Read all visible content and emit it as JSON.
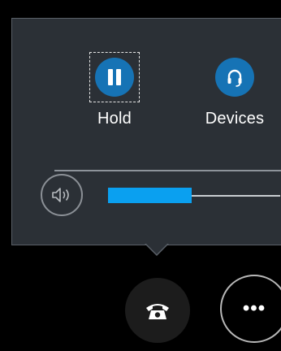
{
  "controls": {
    "hold": {
      "label": "Hold",
      "icon": "pause-icon"
    },
    "devices": {
      "label": "Devices",
      "icon": "headset-icon"
    }
  },
  "volume": {
    "icon": "speaker-icon",
    "level": 0.5
  },
  "bottom_bar": {
    "call_icon": "phone-icon",
    "more_label": "•••"
  },
  "colors": {
    "panel_bg": "#2b3036",
    "accent_blue": "#1673b5",
    "volume_fill": "#0aa0f0"
  }
}
